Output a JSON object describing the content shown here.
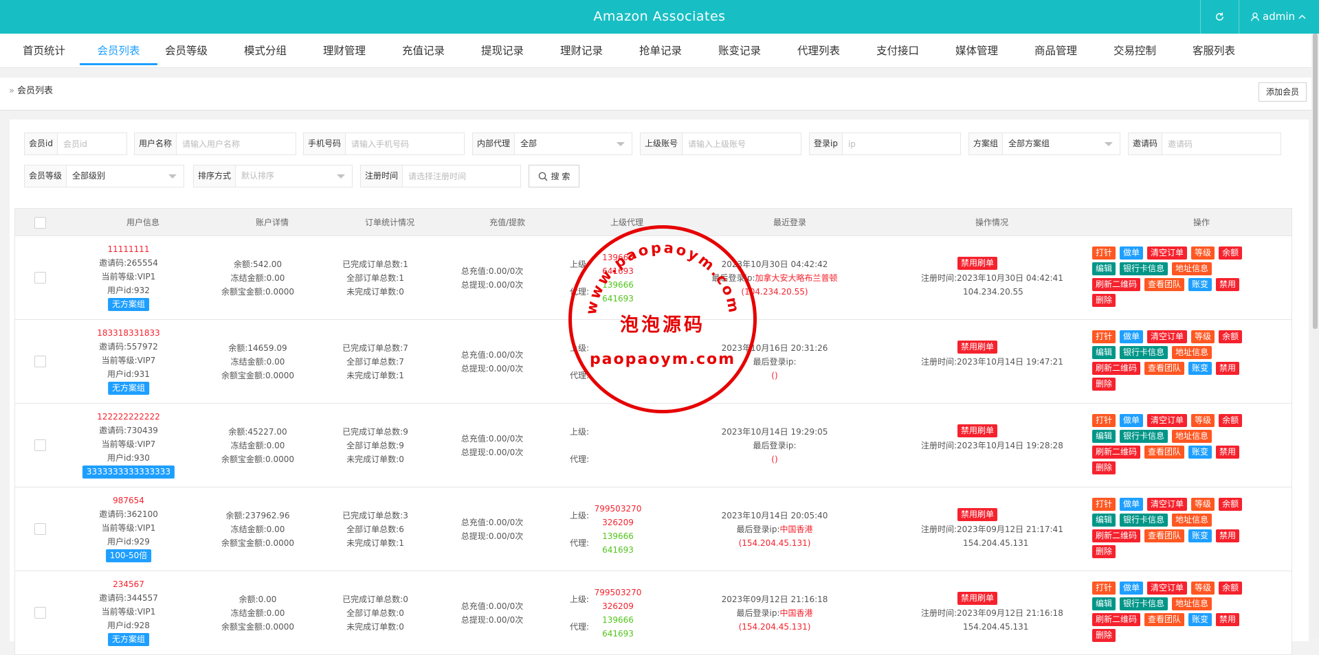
{
  "header": {
    "title": "Amazon Associates",
    "user": "admin",
    "bg_color": "#17bfc4"
  },
  "nav": {
    "items": [
      "首页统计",
      "会员列表",
      "会员等级",
      "模式分组",
      "理财管理",
      "充值记录",
      "提现记录",
      "理财记录",
      "抢单记录",
      "账变记录",
      "代理列表",
      "支付接口",
      "媒体管理",
      "商品管理",
      "交易控制",
      "客服列表"
    ],
    "active_index": 1
  },
  "breadcrumb": {
    "current": "会员列表",
    "add_button": "添加会员"
  },
  "filters": {
    "member_id": {
      "label": "会员id",
      "placeholder": "会员id"
    },
    "username": {
      "label": "用户名称",
      "placeholder": "请输入用户名称"
    },
    "phone": {
      "label": "手机号码",
      "placeholder": "请输入手机号码"
    },
    "internal_agent": {
      "label": "内部代理",
      "value": "全部"
    },
    "parent_account": {
      "label": "上级账号",
      "placeholder": "请输入上级账号"
    },
    "login_ip": {
      "label": "登录ip",
      "placeholder": "ip"
    },
    "scheme_group": {
      "label": "方案组",
      "value": "全部方案组"
    },
    "invite_code": {
      "label": "邀请码",
      "placeholder": "邀请码"
    },
    "member_level": {
      "label": "会员等级",
      "value": "全部级别"
    },
    "sort": {
      "label": "排序方式",
      "value": "默认排序"
    },
    "reg_time": {
      "label": "注册时间",
      "placeholder": "请选择注册时间"
    },
    "search_button": "搜 索"
  },
  "table": {
    "headers": [
      "用户信息",
      "账户详情",
      "订单统计情况",
      "充值/提款",
      "上级代理",
      "最近登录",
      "操作情况",
      "操作"
    ],
    "op_labels": [
      "打针",
      "做单",
      "清空订单",
      "等级",
      "余额",
      "编辑",
      "银行卡信息",
      "地址信息",
      "刷新二维码",
      "查看团队",
      "账变",
      "禁用",
      "删除"
    ],
    "rows": [
      {
        "username": "11111111",
        "invite": "邀请码:265554",
        "level": "当前等级:VIP1",
        "uid": "用户id:932",
        "group": "无方案组",
        "balance": "余额:542.00",
        "frozen": "冻结金额:0.00",
        "yuebao": "余额宝金额:0.0000",
        "done": "已完成订单总数:1",
        "total": "全部订单总数:1",
        "undone": "未完成订单数:0",
        "recharge": "总充值:0.00/0次",
        "withdraw": "总提现:0.00/0次",
        "sup_label": "上级:",
        "sup_a": "139666",
        "sup_b": "641693",
        "agent_label": "代理:",
        "agent_a": "139666",
        "agent_b": "641693",
        "login_time": "2023年10月30日 04:42:42",
        "login_ip_label": "最后登录ip:",
        "login_loc": "加拿大安大略布兰普顿",
        "login_ip": "(104.234.20.55)",
        "ban": "禁用刷单",
        "reg_time": "注册时间:2023年10月30日 04:42:41",
        "reg_ip": "104.234.20.55"
      },
      {
        "username": "183318331833",
        "invite": "邀请码:557972",
        "level": "当前等级:VIP7",
        "uid": "用户id:931",
        "group": "无方案组",
        "balance": "余额:14659.09",
        "frozen": "冻结金额:0.00",
        "yuebao": "余额宝金额:0.0000",
        "done": "已完成订单总数:7",
        "total": "全部订单总数:7",
        "undone": "未完成订单数:1",
        "recharge": "总充值:0.00/0次",
        "withdraw": "总提现:0.00/0次",
        "sup_label": "上级:",
        "sup_a": "",
        "sup_b": "",
        "agent_label": "代理:",
        "agent_a": "",
        "agent_b": "",
        "login_time": "2023年10月16日 20:31:26",
        "login_ip_label": "最后登录ip:",
        "login_loc": "",
        "login_ip": "()",
        "ban": "禁用刷单",
        "reg_time": "注册时间:2023年10月14日 19:47:21",
        "reg_ip": ""
      },
      {
        "username": "122222222222",
        "invite": "邀请码:730439",
        "level": "当前等级:VIP7",
        "uid": "用户id:930",
        "group": "3333333333333333",
        "balance": "余额:45227.00",
        "frozen": "冻结金额:0.00",
        "yuebao": "余额宝金额:0.0000",
        "done": "已完成订单总数:9",
        "total": "全部订单总数:9",
        "undone": "未完成订单数:0",
        "recharge": "总充值:0.00/0次",
        "withdraw": "总提现:0.00/0次",
        "sup_label": "上级:",
        "sup_a": "",
        "sup_b": "",
        "agent_label": "代理:",
        "agent_a": "",
        "agent_b": "",
        "login_time": "2023年10月14日 19:29:05",
        "login_ip_label": "最后登录ip:",
        "login_loc": "",
        "login_ip": "()",
        "ban": "禁用刷单",
        "reg_time": "注册时间:2023年10月14日 19:28:28",
        "reg_ip": ""
      },
      {
        "username": "987654",
        "invite": "邀请码:362100",
        "level": "当前等级:VIP1",
        "uid": "用户id:929",
        "group": "100-50倍",
        "balance": "余额:237962.96",
        "frozen": "冻结金额:0.00",
        "yuebao": "余额宝金额:0.0000",
        "done": "已完成订单总数:3",
        "total": "全部订单总数:6",
        "undone": "未完成订单数:1",
        "recharge": "总充值:0.00/0次",
        "withdraw": "总提现:0.00/0次",
        "sup_label": "上级:",
        "sup_a": "799503270",
        "sup_b": "326209",
        "agent_label": "代理:",
        "agent_a": "139666",
        "agent_b": "641693",
        "login_time": "2023年10月14日 20:05:40",
        "login_ip_label": "最后登录ip:",
        "login_loc": "中国香港",
        "login_ip": "(154.204.45.131)",
        "ban": "禁用刷单",
        "reg_time": "注册时间:2023年09月12日 21:17:41",
        "reg_ip": "154.204.45.131"
      },
      {
        "username": "234567",
        "invite": "邀请码:344557",
        "level": "当前等级:VIP1",
        "uid": "用户id:928",
        "group": "无方案组",
        "balance": "余额:0.00",
        "frozen": "冻结金额:0.00",
        "yuebao": "余额宝金额:0.0000",
        "done": "已完成订单总数:0",
        "total": "全部订单总数:0",
        "undone": "未完成订单数:0",
        "recharge": "总充值:0.00/0次",
        "withdraw": "总提现:0.00/0次",
        "sup_label": "上级:",
        "sup_a": "799503270",
        "sup_b": "326209",
        "agent_label": "代理:",
        "agent_a": "139666",
        "agent_b": "641693",
        "login_time": "2023年09月12日 21:16:18",
        "login_ip_label": "最后登录ip:",
        "login_loc": "中国香港",
        "login_ip": "(154.204.45.131)",
        "ban": "禁用刷单",
        "reg_time": "注册时间:2023年09月12日 21:16:18",
        "reg_ip": "154.204.45.131"
      }
    ]
  },
  "watermark": {
    "arc_text": "www.paopaoym.com",
    "center_text": "泡泡源码",
    "bottom_text": "paopaoym.com"
  }
}
